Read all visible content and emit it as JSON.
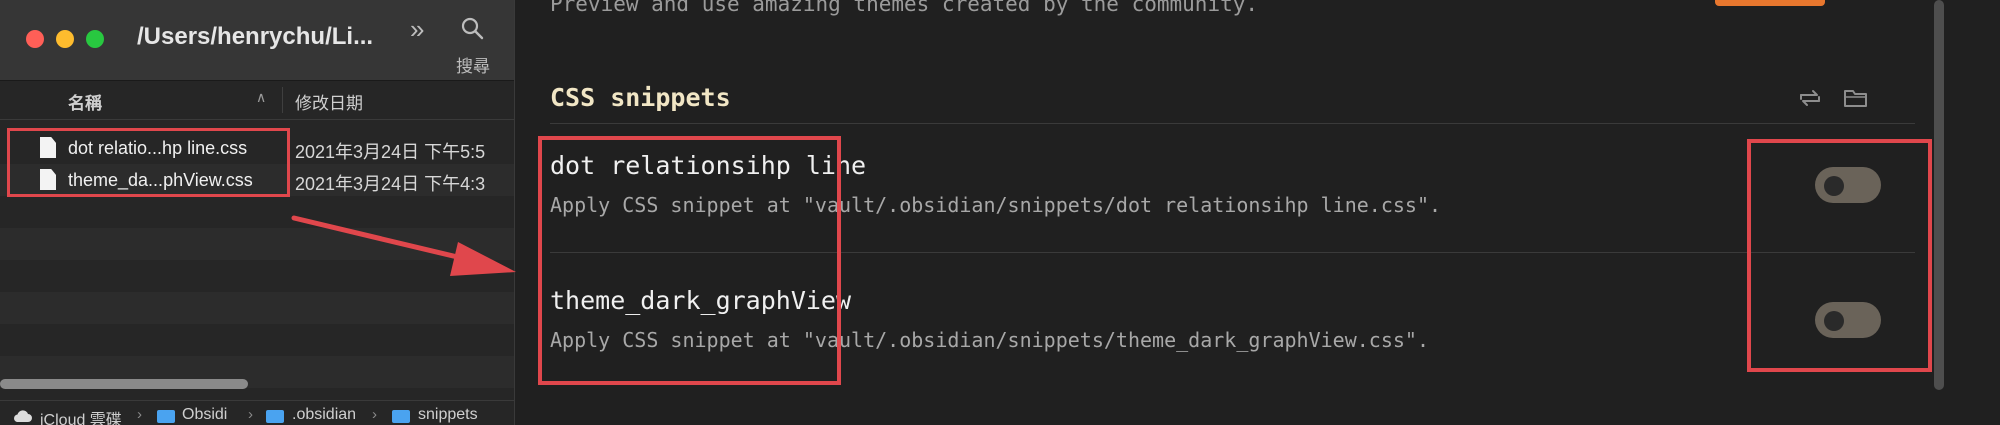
{
  "finder": {
    "title": "/Users/henrychu/Li...",
    "search_label": "搜尋",
    "columns": {
      "name": "名稱",
      "date": "修改日期"
    },
    "files": [
      {
        "name": "dot relatio...hp line.css",
        "date": "2021年3月24日 下午5:5"
      },
      {
        "name": "theme_da...phView.css",
        "date": "2021年3月24日 下午4:3"
      }
    ],
    "path": [
      "iCloud 雲碟",
      "Obsidi",
      ".obsidian",
      "snippets"
    ]
  },
  "obsidian": {
    "subtitle": "Preview and use amazing themes created by the community.",
    "section_title": "CSS snippets",
    "snippets": [
      {
        "title": "dot relationsihp line",
        "description": "Apply CSS snippet at \"vault/.obsidian/snippets/dot relationsihp line.css\".",
        "enabled": false
      },
      {
        "title": "theme_dark_graphView",
        "description": "Apply CSS snippet at \"vault/.obsidian/snippets/theme_dark_graphView.css\".",
        "enabled": false
      }
    ]
  },
  "colors": {
    "annotation": "#e0474c",
    "accent_orange": "#e8772e",
    "heading": "#f1e6c5"
  },
  "icons": [
    "more-icon",
    "search-icon",
    "file-icon",
    "cloud-icon",
    "folder-icon",
    "reload-icon",
    "open-folder-icon"
  ]
}
